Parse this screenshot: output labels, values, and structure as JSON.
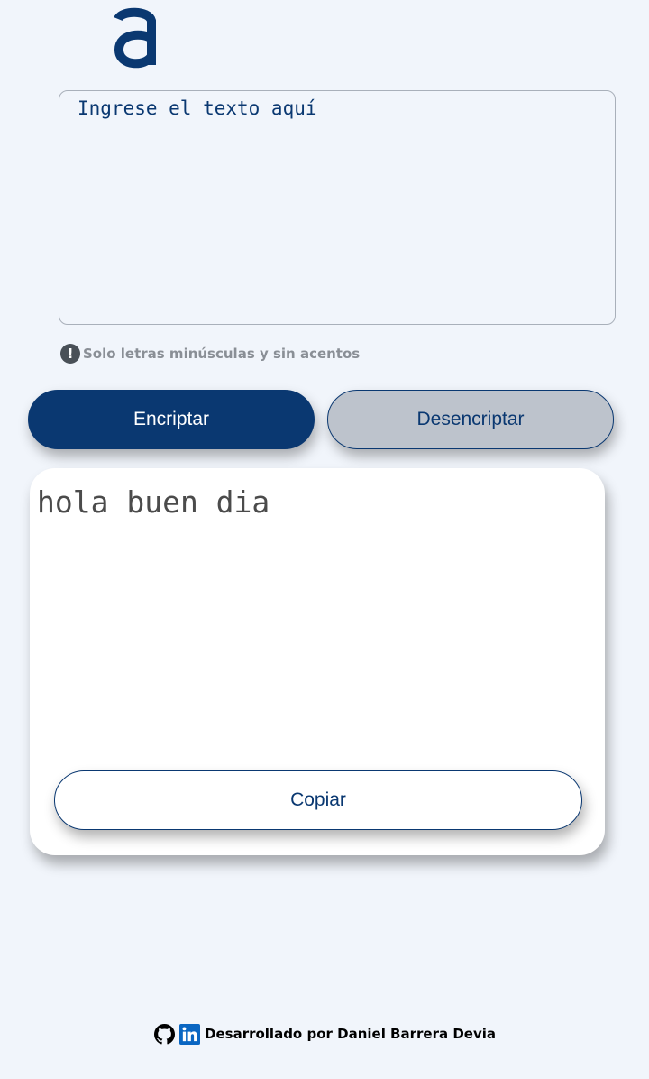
{
  "header": {
    "logo_letter": "a",
    "logo_color": "#0A3871"
  },
  "input": {
    "placeholder": "Ingrese el texto aquí",
    "value": ""
  },
  "hint": {
    "icon": "exclamation-circle-icon",
    "icon_glyph": "!",
    "text": "Solo letras minúsculas y sin acentos"
  },
  "actions": {
    "encrypt_label": "Encriptar",
    "decrypt_label": "Desencriptar"
  },
  "output": {
    "text": "hola buen dia",
    "copy_label": "Copiar"
  },
  "footer": {
    "github_icon": "github-icon",
    "linkedin_icon": "linkedin-icon",
    "credit_text": "Desarrollado por Daniel Barrera Devia"
  },
  "colors": {
    "primary": "#0A3871",
    "background": "#F1F5FB",
    "secondary_button": "#BDC3CC",
    "hint_text": "#8A8F96",
    "output_text": "#4B4B4B",
    "linkedin": "#0A66C2"
  }
}
